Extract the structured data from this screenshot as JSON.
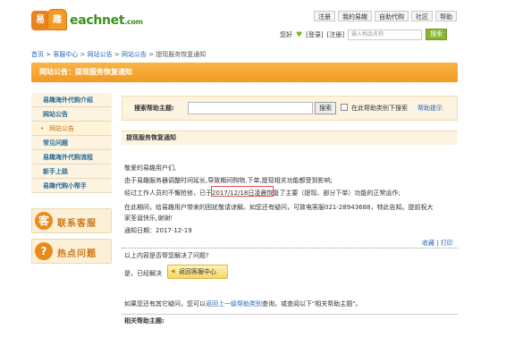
{
  "logo": {
    "mark1": "易",
    "mark2": "趣",
    "name": "eachnet",
    "suffix": ".com"
  },
  "topnav": [
    "注册",
    "我的易趣",
    "自助代购",
    "社区",
    "帮助"
  ],
  "userbar": {
    "greeting": "您好",
    "login": "[登录]",
    "register": "[注册]",
    "search_placeholder": "输入物品名称",
    "search_btn": "搜索"
  },
  "breadcrumb": [
    "首页",
    "客服中心",
    "网站公告",
    "网站公告",
    "提现服务恢复通知"
  ],
  "banner": "网站公告：提现服务恢复通知",
  "sidebar": [
    {
      "label": "易趣海外代购介绍",
      "type": "cat"
    },
    {
      "label": "网站公告",
      "type": "cat"
    },
    {
      "label": "网站公告",
      "type": "active"
    },
    {
      "label": "常见问题",
      "type": "cat"
    },
    {
      "label": "易趣海外代购流程",
      "type": "cat"
    },
    {
      "label": "新手上路",
      "type": "cat"
    },
    {
      "label": "易趣代购小帮手",
      "type": "cat"
    }
  ],
  "promo": {
    "service": "联系客服",
    "service_icon": "客",
    "hot": "热点问题",
    "hot_icon": "?"
  },
  "search": {
    "label": "搜索帮助主题:",
    "button": "搜索",
    "checkbox_label": "在此帮助类别下搜索",
    "tips": "帮助提示"
  },
  "content": {
    "heading": "提现服务恢复通知",
    "p1": "敬爱的易趣用户们,",
    "p2": "由于易趣服务器调整时间延长,导致期间购物,下单,提现相关功能都受到影响;",
    "p3": "经过工作人员的不懈抢修，已于2017/12/18日凌晨恢复了主要（提现、部分下单）功能的正常运作;",
    "p4": "在此期间，给易趣用户带来的困扰敬请谅解。如您还有疑问，可致电客服021-28943688，特此告知。提前祝大",
    "p5": "家圣诞快乐,谢谢!",
    "date": "通知日期：2017-12-19"
  },
  "links": {
    "fav": "收藏",
    "print": "打印"
  },
  "feedback": {
    "question": "以上内容是否帮您解决了问题?",
    "yes": "是，已经解决",
    "back": "返回客服中心"
  },
  "help_more": {
    "prefix": "如果您还有其它疑问，您可以",
    "link": "返回上一级帮助类别",
    "suffix": "查询，或查阅以下\"相关帮助主题\"。"
  },
  "related": "相关帮助主题:"
}
